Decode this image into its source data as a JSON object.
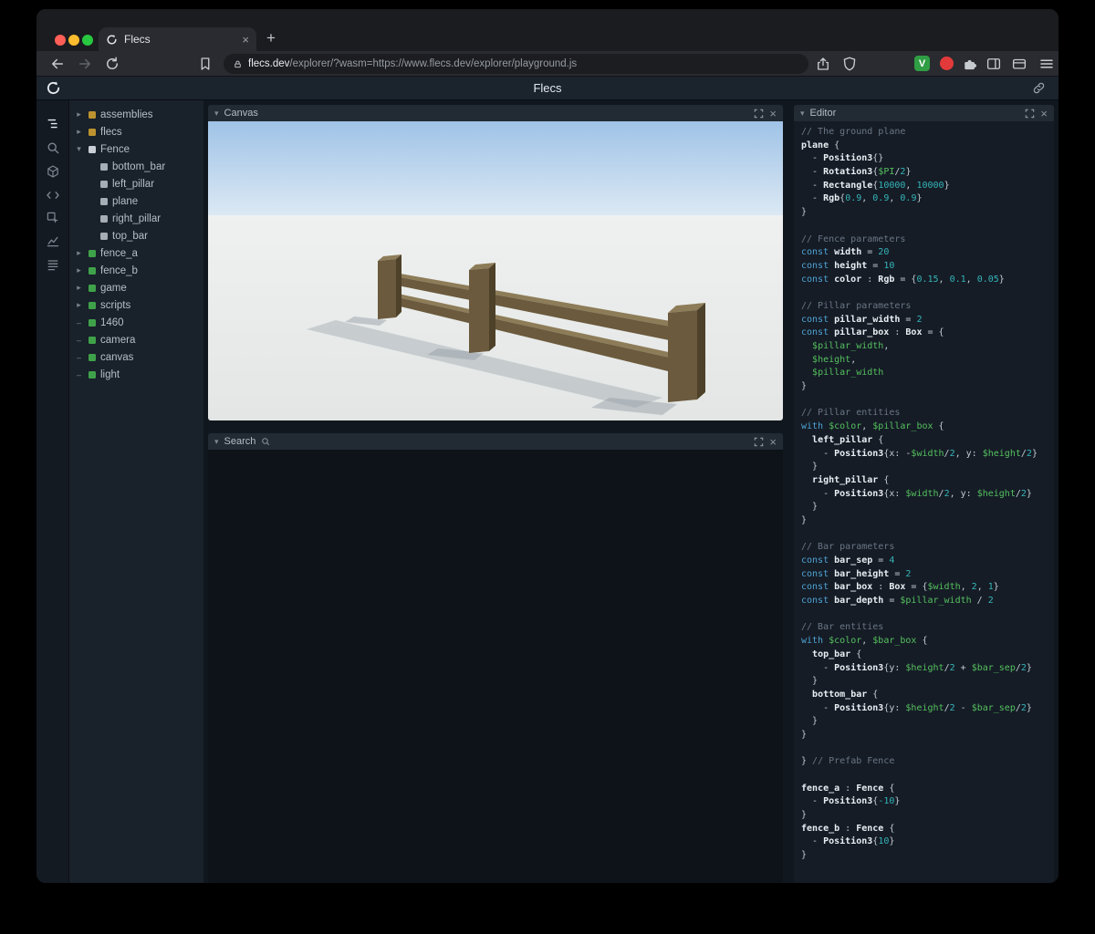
{
  "browser": {
    "traffic_colors": [
      "#ff5f57",
      "#febc2e",
      "#28c840"
    ],
    "tab": {
      "title": "Flecs",
      "close": "×"
    },
    "new_tab": "+",
    "url": {
      "domain": "flecs.dev",
      "path": "/explorer/?wasm=https://www.flecs.dev/explorer/playground.js"
    },
    "extensions": {
      "v_label": "V",
      "v_color": "#2f9e44",
      "red_color": "#e23a3a"
    }
  },
  "header": {
    "title": "Flecs"
  },
  "sidebar": {
    "icons": [
      "entity-tree",
      "search",
      "cube",
      "code",
      "inspect",
      "chart",
      "stats"
    ]
  },
  "tree": {
    "type_colors": {
      "module": "#bd932f",
      "prefab": "#c9cfd5",
      "entity": "#3fa24a",
      "child": "#a6adb4"
    },
    "items": [
      {
        "label": "assemblies",
        "type": "module",
        "expander": "collapsed",
        "depth": 0
      },
      {
        "label": "flecs",
        "type": "module",
        "expander": "collapsed",
        "depth": 0
      },
      {
        "label": "Fence",
        "type": "prefab",
        "expander": "expanded",
        "depth": 0
      },
      {
        "label": "bottom_bar",
        "type": "child",
        "expander": "none",
        "depth": 1
      },
      {
        "label": "left_pillar",
        "type": "child",
        "expander": "none",
        "depth": 1
      },
      {
        "label": "plane",
        "type": "child",
        "expander": "none",
        "depth": 1
      },
      {
        "label": "right_pillar",
        "type": "child",
        "expander": "none",
        "depth": 1
      },
      {
        "label": "top_bar",
        "type": "child",
        "expander": "none",
        "depth": 1
      },
      {
        "label": "fence_a",
        "type": "entity",
        "expander": "collapsed",
        "depth": 0
      },
      {
        "label": "fence_b",
        "type": "entity",
        "expander": "collapsed",
        "depth": 0
      },
      {
        "label": "game",
        "type": "entity",
        "expander": "collapsed",
        "depth": 0
      },
      {
        "label": "scripts",
        "type": "entity",
        "expander": "collapsed",
        "depth": 0
      },
      {
        "label": "1460",
        "type": "entity",
        "expander": "dash",
        "depth": 0
      },
      {
        "label": "camera",
        "type": "entity",
        "expander": "dash",
        "depth": 0
      },
      {
        "label": "canvas",
        "type": "entity",
        "expander": "dash",
        "depth": 0
      },
      {
        "label": "light",
        "type": "entity",
        "expander": "dash",
        "depth": 0
      }
    ]
  },
  "panels": {
    "canvas": {
      "title": "Canvas"
    },
    "search": {
      "title": "Search"
    },
    "editor": {
      "title": "Editor"
    }
  },
  "scene": {
    "sky_top": "#9fc3e7",
    "sky_bottom": "#dce9f4",
    "ground_far": "#eff1f0",
    "ground_near": "#e3e6e5",
    "fence_front": "#6b5a3d",
    "fence_top": "#8d7c58",
    "fence_side": "#4e4129",
    "shadow": "#97a0a8"
  },
  "code": {
    "lines": [
      [
        {
          "t": "c",
          "s": "// The ground plane"
        }
      ],
      [
        {
          "t": "i",
          "s": "plane"
        },
        {
          "t": "p",
          "s": " {"
        }
      ],
      [
        {
          "t": "p",
          "s": "  - "
        },
        {
          "t": "t",
          "s": "Position3"
        },
        {
          "t": "p",
          "s": "{}"
        }
      ],
      [
        {
          "t": "p",
          "s": "  - "
        },
        {
          "t": "t",
          "s": "Rotation3"
        },
        {
          "t": "p",
          "s": "{"
        },
        {
          "t": "v",
          "s": "$PI"
        },
        {
          "t": "p",
          "s": "/"
        },
        {
          "t": "n",
          "s": "2"
        },
        {
          "t": "p",
          "s": "}"
        }
      ],
      [
        {
          "t": "p",
          "s": "  - "
        },
        {
          "t": "t",
          "s": "Rectangle"
        },
        {
          "t": "p",
          "s": "{"
        },
        {
          "t": "n",
          "s": "10000"
        },
        {
          "t": "p",
          "s": ", "
        },
        {
          "t": "n",
          "s": "10000"
        },
        {
          "t": "p",
          "s": "}"
        }
      ],
      [
        {
          "t": "p",
          "s": "  - "
        },
        {
          "t": "t",
          "s": "Rgb"
        },
        {
          "t": "p",
          "s": "{"
        },
        {
          "t": "n",
          "s": "0.9"
        },
        {
          "t": "p",
          "s": ", "
        },
        {
          "t": "n",
          "s": "0.9"
        },
        {
          "t": "p",
          "s": ", "
        },
        {
          "t": "n",
          "s": "0.9"
        },
        {
          "t": "p",
          "s": "}"
        }
      ],
      [
        {
          "t": "p",
          "s": "}"
        }
      ],
      [],
      [
        {
          "t": "c",
          "s": "// Fence parameters"
        }
      ],
      [
        {
          "t": "k",
          "s": "const "
        },
        {
          "t": "i",
          "s": "width"
        },
        {
          "t": "p",
          "s": " = "
        },
        {
          "t": "n",
          "s": "20"
        }
      ],
      [
        {
          "t": "k",
          "s": "const "
        },
        {
          "t": "i",
          "s": "height"
        },
        {
          "t": "p",
          "s": " = "
        },
        {
          "t": "n",
          "s": "10"
        }
      ],
      [
        {
          "t": "k",
          "s": "const "
        },
        {
          "t": "i",
          "s": "color"
        },
        {
          "t": "p",
          "s": " : "
        },
        {
          "t": "t",
          "s": "Rgb"
        },
        {
          "t": "p",
          "s": " = {"
        },
        {
          "t": "n",
          "s": "0.15"
        },
        {
          "t": "p",
          "s": ", "
        },
        {
          "t": "n",
          "s": "0.1"
        },
        {
          "t": "p",
          "s": ", "
        },
        {
          "t": "n",
          "s": "0.05"
        },
        {
          "t": "p",
          "s": "}"
        }
      ],
      [],
      [
        {
          "t": "c",
          "s": "// Pillar parameters"
        }
      ],
      [
        {
          "t": "k",
          "s": "const "
        },
        {
          "t": "i",
          "s": "pillar_width"
        },
        {
          "t": "p",
          "s": " = "
        },
        {
          "t": "n",
          "s": "2"
        }
      ],
      [
        {
          "t": "k",
          "s": "const "
        },
        {
          "t": "i",
          "s": "pillar_box"
        },
        {
          "t": "p",
          "s": " : "
        },
        {
          "t": "t",
          "s": "Box"
        },
        {
          "t": "p",
          "s": " = {"
        }
      ],
      [
        {
          "t": "p",
          "s": "  "
        },
        {
          "t": "v",
          "s": "$pillar_width"
        },
        {
          "t": "p",
          "s": ","
        }
      ],
      [
        {
          "t": "p",
          "s": "  "
        },
        {
          "t": "v",
          "s": "$height"
        },
        {
          "t": "p",
          "s": ","
        }
      ],
      [
        {
          "t": "p",
          "s": "  "
        },
        {
          "t": "v",
          "s": "$pillar_width"
        }
      ],
      [
        {
          "t": "p",
          "s": "}"
        }
      ],
      [],
      [
        {
          "t": "c",
          "s": "// Pillar entities"
        }
      ],
      [
        {
          "t": "k",
          "s": "with "
        },
        {
          "t": "v",
          "s": "$color"
        },
        {
          "t": "p",
          "s": ", "
        },
        {
          "t": "v",
          "s": "$pillar_box"
        },
        {
          "t": "p",
          "s": " {"
        }
      ],
      [
        {
          "t": "p",
          "s": "  "
        },
        {
          "t": "i",
          "s": "left_pillar"
        },
        {
          "t": "p",
          "s": " {"
        }
      ],
      [
        {
          "t": "p",
          "s": "    - "
        },
        {
          "t": "t",
          "s": "Position3"
        },
        {
          "t": "p",
          "s": "{x: -"
        },
        {
          "t": "v",
          "s": "$width"
        },
        {
          "t": "p",
          "s": "/"
        },
        {
          "t": "n",
          "s": "2"
        },
        {
          "t": "p",
          "s": ", y: "
        },
        {
          "t": "v",
          "s": "$height"
        },
        {
          "t": "p",
          "s": "/"
        },
        {
          "t": "n",
          "s": "2"
        },
        {
          "t": "p",
          "s": "}"
        }
      ],
      [
        {
          "t": "p",
          "s": "  }"
        }
      ],
      [
        {
          "t": "p",
          "s": "  "
        },
        {
          "t": "i",
          "s": "right_pillar"
        },
        {
          "t": "p",
          "s": " {"
        }
      ],
      [
        {
          "t": "p",
          "s": "    - "
        },
        {
          "t": "t",
          "s": "Position3"
        },
        {
          "t": "p",
          "s": "{x: "
        },
        {
          "t": "v",
          "s": "$width"
        },
        {
          "t": "p",
          "s": "/"
        },
        {
          "t": "n",
          "s": "2"
        },
        {
          "t": "p",
          "s": ", y: "
        },
        {
          "t": "v",
          "s": "$height"
        },
        {
          "t": "p",
          "s": "/"
        },
        {
          "t": "n",
          "s": "2"
        },
        {
          "t": "p",
          "s": "}"
        }
      ],
      [
        {
          "t": "p",
          "s": "  }"
        }
      ],
      [
        {
          "t": "p",
          "s": "}"
        }
      ],
      [],
      [
        {
          "t": "c",
          "s": "// Bar parameters"
        }
      ],
      [
        {
          "t": "k",
          "s": "const "
        },
        {
          "t": "i",
          "s": "bar_sep"
        },
        {
          "t": "p",
          "s": " = "
        },
        {
          "t": "n",
          "s": "4"
        }
      ],
      [
        {
          "t": "k",
          "s": "const "
        },
        {
          "t": "i",
          "s": "bar_height"
        },
        {
          "t": "p",
          "s": " = "
        },
        {
          "t": "n",
          "s": "2"
        }
      ],
      [
        {
          "t": "k",
          "s": "const "
        },
        {
          "t": "i",
          "s": "bar_box"
        },
        {
          "t": "p",
          "s": " : "
        },
        {
          "t": "t",
          "s": "Box"
        },
        {
          "t": "p",
          "s": " = {"
        },
        {
          "t": "v",
          "s": "$width"
        },
        {
          "t": "p",
          "s": ", "
        },
        {
          "t": "n",
          "s": "2"
        },
        {
          "t": "p",
          "s": ", "
        },
        {
          "t": "n",
          "s": "1"
        },
        {
          "t": "p",
          "s": "}"
        }
      ],
      [
        {
          "t": "k",
          "s": "const "
        },
        {
          "t": "i",
          "s": "bar_depth"
        },
        {
          "t": "p",
          "s": " = "
        },
        {
          "t": "v",
          "s": "$pillar_width"
        },
        {
          "t": "p",
          "s": " / "
        },
        {
          "t": "n",
          "s": "2"
        }
      ],
      [],
      [
        {
          "t": "c",
          "s": "// Bar entities"
        }
      ],
      [
        {
          "t": "k",
          "s": "with "
        },
        {
          "t": "v",
          "s": "$color"
        },
        {
          "t": "p",
          "s": ", "
        },
        {
          "t": "v",
          "s": "$bar_box"
        },
        {
          "t": "p",
          "s": " {"
        }
      ],
      [
        {
          "t": "p",
          "s": "  "
        },
        {
          "t": "i",
          "s": "top_bar"
        },
        {
          "t": "p",
          "s": " {"
        }
      ],
      [
        {
          "t": "p",
          "s": "    - "
        },
        {
          "t": "t",
          "s": "Position3"
        },
        {
          "t": "p",
          "s": "{y: "
        },
        {
          "t": "v",
          "s": "$height"
        },
        {
          "t": "p",
          "s": "/"
        },
        {
          "t": "n",
          "s": "2"
        },
        {
          "t": "p",
          "s": " + "
        },
        {
          "t": "v",
          "s": "$bar_sep"
        },
        {
          "t": "p",
          "s": "/"
        },
        {
          "t": "n",
          "s": "2"
        },
        {
          "t": "p",
          "s": "}"
        }
      ],
      [
        {
          "t": "p",
          "s": "  }"
        }
      ],
      [
        {
          "t": "p",
          "s": "  "
        },
        {
          "t": "i",
          "s": "bottom_bar"
        },
        {
          "t": "p",
          "s": " {"
        }
      ],
      [
        {
          "t": "p",
          "s": "    - "
        },
        {
          "t": "t",
          "s": "Position3"
        },
        {
          "t": "p",
          "s": "{y: "
        },
        {
          "t": "v",
          "s": "$height"
        },
        {
          "t": "p",
          "s": "/"
        },
        {
          "t": "n",
          "s": "2"
        },
        {
          "t": "p",
          "s": " - "
        },
        {
          "t": "v",
          "s": "$bar_sep"
        },
        {
          "t": "p",
          "s": "/"
        },
        {
          "t": "n",
          "s": "2"
        },
        {
          "t": "p",
          "s": "}"
        }
      ],
      [
        {
          "t": "p",
          "s": "  }"
        }
      ],
      [
        {
          "t": "p",
          "s": "}"
        }
      ],
      [],
      [
        {
          "t": "p",
          "s": "} "
        },
        {
          "t": "c",
          "s": "// Prefab Fence"
        }
      ],
      [],
      [
        {
          "t": "i",
          "s": "fence_a"
        },
        {
          "t": "p",
          "s": " : "
        },
        {
          "t": "t",
          "s": "Fence"
        },
        {
          "t": "p",
          "s": " {"
        }
      ],
      [
        {
          "t": "p",
          "s": "  - "
        },
        {
          "t": "t",
          "s": "Position3"
        },
        {
          "t": "p",
          "s": "{"
        },
        {
          "t": "n",
          "s": "-10"
        },
        {
          "t": "p",
          "s": "}"
        }
      ],
      [
        {
          "t": "p",
          "s": "}"
        }
      ],
      [
        {
          "t": "i",
          "s": "fence_b"
        },
        {
          "t": "p",
          "s": " : "
        },
        {
          "t": "t",
          "s": "Fence"
        },
        {
          "t": "p",
          "s": " {"
        }
      ],
      [
        {
          "t": "p",
          "s": "  - "
        },
        {
          "t": "t",
          "s": "Position3"
        },
        {
          "t": "p",
          "s": "{"
        },
        {
          "t": "n",
          "s": "10"
        },
        {
          "t": "p",
          "s": "}"
        }
      ],
      [
        {
          "t": "p",
          "s": "}"
        }
      ]
    ]
  }
}
